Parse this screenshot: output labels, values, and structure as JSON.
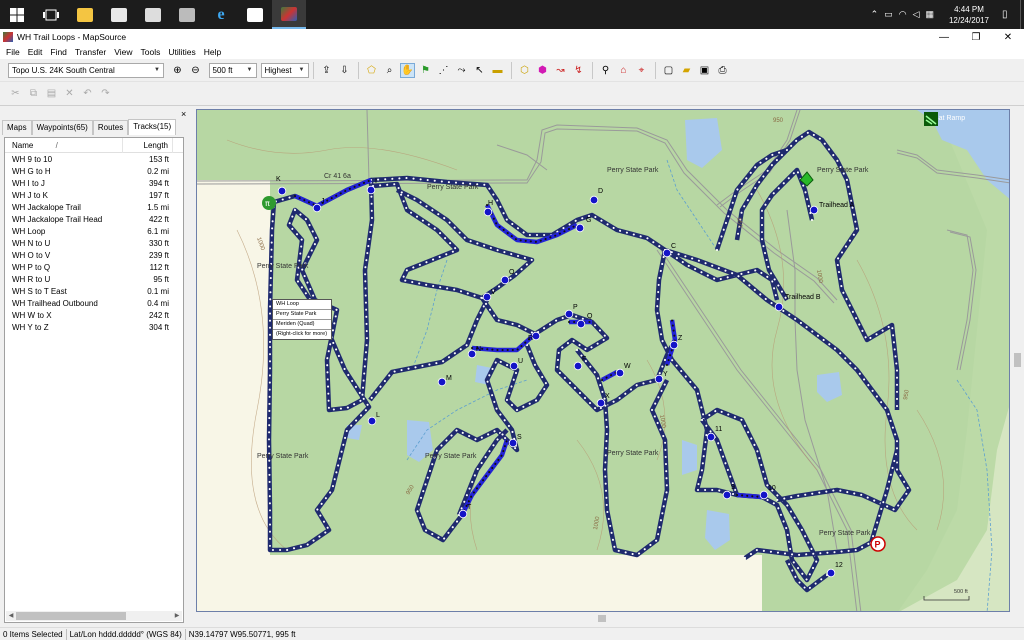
{
  "window": {
    "title": "WH Trail Loops - MapSource",
    "min": "—",
    "max": "❐",
    "close": "✕"
  },
  "taskbar": {
    "time": "4:44 PM",
    "date": "12/24/2017",
    "start_icon": "windows-icon"
  },
  "menu": [
    "File",
    "Edit",
    "Find",
    "Transfer",
    "View",
    "Tools",
    "Utilities",
    "Help"
  ],
  "toolbar": {
    "map_product": "Topo U.S. 24K South Central",
    "zoom_scale": "500 ft",
    "detail": "Highest"
  },
  "leftpanel": {
    "tabs": [
      "Maps",
      "Waypoints(65)",
      "Routes",
      "Tracks(15)"
    ],
    "active_tab": "Tracks(15)",
    "columns": {
      "name": "Name",
      "sort": "/",
      "length": "Length"
    },
    "rows": [
      {
        "name": "WH 9 to 10",
        "length": "153 ft"
      },
      {
        "name": "WH G to H",
        "length": "0.2 mi"
      },
      {
        "name": "WH I to J",
        "length": "394 ft"
      },
      {
        "name": "WH J to K",
        "length": "197 ft"
      },
      {
        "name": "WH Jackalope Trail",
        "length": "1.5 mi"
      },
      {
        "name": "WH Jackalope Trail Head",
        "length": "422 ft"
      },
      {
        "name": "WH Loop",
        "length": "6.1 mi"
      },
      {
        "name": "WH N to U",
        "length": "330 ft"
      },
      {
        "name": "WH O to V",
        "length": "239 ft"
      },
      {
        "name": "WH P to Q",
        "length": "112 ft"
      },
      {
        "name": "WH R to U",
        "length": "95 ft"
      },
      {
        "name": "WH S to T East",
        "length": "0.1 mi"
      },
      {
        "name": "WH Trailhead Outbound",
        "length": "0.4 mi"
      },
      {
        "name": "WH W to X",
        "length": "242 ft"
      },
      {
        "name": "WH Y to Z",
        "length": "304 ft"
      }
    ]
  },
  "map": {
    "labels": {
      "perry1": "Perry State Park",
      "perry2": "Perry State Park",
      "perry3": "Perry State Park",
      "perry4": "Perry State Park",
      "perry5": "Perry State Park",
      "perry6": "Perry State Park",
      "perry7": "Perry State Park",
      "perry8": "Perry State Park",
      "road": "Cr 41 6a",
      "bat_ramp": "Bat Ramp",
      "trailhead_a": "Trailhead A",
      "trailhead_b": "Trailhead B",
      "c950": "950",
      "c1000a": "1000",
      "c1000b": "1000",
      "c1000c": "1000",
      "c950b": "950",
      "c950c": "950",
      "c950d": "950",
      "c1000d": "1000",
      "scale": "500 ft"
    },
    "waypoints": [
      "K",
      "J",
      "I",
      "H",
      "G",
      "D",
      "C",
      "O",
      "V",
      "P",
      "Q",
      "R",
      "N",
      "U",
      "M",
      "L",
      "F",
      "W",
      "Y",
      "Z",
      "X",
      "S",
      "T",
      "11",
      "9",
      "10",
      "12"
    ],
    "context_menu": [
      "WH Loop",
      "Perry State Park",
      "Meriden (Quad)",
      "(Right-click for more)"
    ]
  },
  "status": {
    "items_selected": "0 Items Selected",
    "format": "Lat/Lon hddd.ddddd° (WGS 84)",
    "position": "N39.14797 W95.50771, 995 ft"
  },
  "colors": {
    "track": "#1f2a6e",
    "track_selected": "#2323d6",
    "park": "#b5d6a0",
    "water": "#a8c8ec",
    "land": "#f6f4e4"
  }
}
